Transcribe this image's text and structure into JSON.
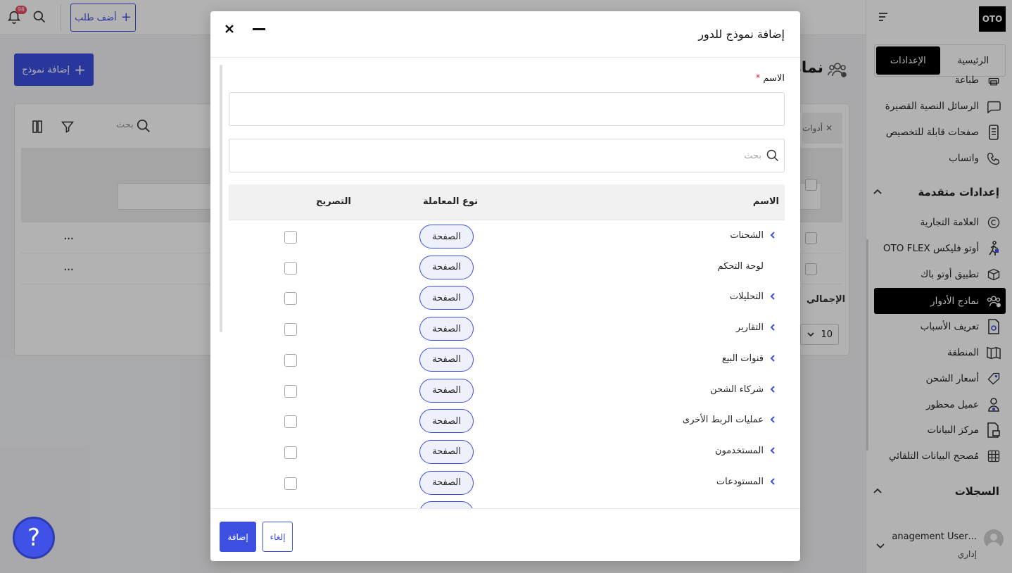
{
  "topbar": {
    "notification_count": "98",
    "add_order_label": "أضف طلب"
  },
  "main": {
    "add_template_label": "إضافة نموذج",
    "page_title": "نماذج الأدوار",
    "tools_label": "أدوات",
    "search_placeholder": "بحث",
    "rows": [
      {
        "actions": "..."
      },
      {
        "actions": "..."
      }
    ],
    "total_label": "الإجمالي",
    "page_size": "10"
  },
  "sidebar": {
    "logo": "OTO",
    "tabs": [
      {
        "label": "الرئيسية"
      },
      {
        "label": "الإعدادات"
      }
    ],
    "items": [
      {
        "label": "طباعة",
        "icon": "printer-icon"
      },
      {
        "label": "الرسائل النصية القصيرة",
        "icon": "chat-icon"
      },
      {
        "label": "صفحات قابلة للتخصيص",
        "icon": "phone-page-icon"
      },
      {
        "label": "واتساب",
        "icon": "phone-icon"
      }
    ],
    "advanced_section": "إعدادات متقدمة",
    "advanced_items": [
      {
        "label": "العلامة التجارية",
        "icon": "copyright-icon"
      },
      {
        "label": "أوتو فليكس OTO FLEX",
        "icon": "runner-icon"
      },
      {
        "label": "تطبيق أوتو باك",
        "icon": "box-icon"
      },
      {
        "label": "نماذج الأدوار",
        "icon": "users-icon"
      },
      {
        "label": "تعريف الأسباب",
        "icon": "doc-gear-icon"
      },
      {
        "label": "المنطقة",
        "icon": "map-icon"
      },
      {
        "label": "أسعار الشحن",
        "icon": "tag-icon"
      },
      {
        "label": "عميل محظور",
        "icon": "blocked-user-icon"
      },
      {
        "label": "مركز البيانات",
        "icon": "data-center-icon"
      },
      {
        "label": "مُصحح البيانات التلقائي",
        "icon": "auto-fix-icon"
      }
    ],
    "logs_section": "السجلات",
    "user": {
      "name": "...anagement User",
      "role": "إداري"
    }
  },
  "modal": {
    "title": "إضافة نموذج للدور",
    "name_label": "الاسم",
    "required_mark": "*",
    "search_placeholder": "بحث",
    "columns": {
      "name": "الاسم",
      "type": "نوع المعاملة",
      "permission": "التصريح"
    },
    "rows": [
      {
        "name": "الشحنات",
        "type": "الصفحة",
        "expandable": true
      },
      {
        "name": "لوحة التحكم",
        "type": "الصفحة",
        "expandable": false
      },
      {
        "name": "التحليلات",
        "type": "الصفحة",
        "expandable": true
      },
      {
        "name": "التقارير",
        "type": "الصفحة",
        "expandable": true
      },
      {
        "name": "قنوات البيع",
        "type": "الصفحة",
        "expandable": true
      },
      {
        "name": "شركاء الشحن",
        "type": "الصفحة",
        "expandable": true
      },
      {
        "name": "عمليات الربط الأخرى",
        "type": "الصفحة",
        "expandable": true
      },
      {
        "name": "المستخدمون",
        "type": "الصفحة",
        "expandable": true
      },
      {
        "name": "المستودعات",
        "type": "الصفحة",
        "expandable": true
      }
    ],
    "confirm_label": "إضافة",
    "cancel_label": "إلغاء"
  },
  "help": {
    "label": "?"
  },
  "colors": {
    "accent": "#3c4fe0",
    "dark": "#000000",
    "pill_bg": "#eef0fb"
  }
}
